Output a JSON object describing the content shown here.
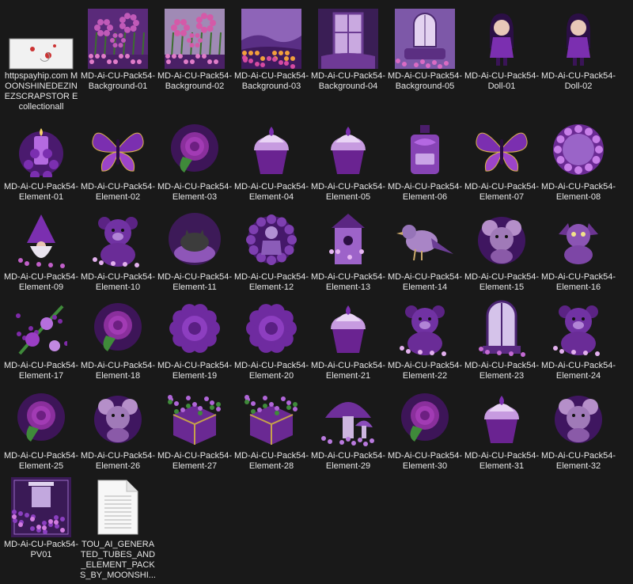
{
  "files": [
    {
      "name": "httpspayhip.com MOONSHINEDEZINEZSCRAPSTOR Ecollectionall",
      "icon": "shortcut-image-icon",
      "kind": "link"
    },
    {
      "name": "MD-Ai-CU-Pack54-Background-01",
      "icon": "garden-background-icon",
      "kind": "bg1"
    },
    {
      "name": "MD-Ai-CU-Pack54-Background-02",
      "icon": "garden-background-icon",
      "kind": "bg2"
    },
    {
      "name": "MD-Ai-CU-Pack54-Background-03",
      "icon": "landscape-background-icon",
      "kind": "bg3"
    },
    {
      "name": "MD-Ai-CU-Pack54-Background-04",
      "icon": "window-background-icon",
      "kind": "bg4"
    },
    {
      "name": "MD-Ai-CU-Pack54-Background-05",
      "icon": "window-background-icon",
      "kind": "bg5"
    },
    {
      "name": "MD-Ai-CU-Pack54-Doll-01",
      "icon": "doll-icon",
      "kind": "doll"
    },
    {
      "name": "MD-Ai-CU-Pack54-Doll-02",
      "icon": "doll-icon",
      "kind": "doll"
    },
    {
      "name": "MD-Ai-CU-Pack54-Element-01",
      "icon": "candle-icon",
      "kind": "candle"
    },
    {
      "name": "MD-Ai-CU-Pack54-Element-02",
      "icon": "butterfly-icon",
      "kind": "butterfly"
    },
    {
      "name": "MD-Ai-CU-Pack54-Element-03",
      "icon": "rose-icon",
      "kind": "rose"
    },
    {
      "name": "MD-Ai-CU-Pack54-Element-04",
      "icon": "cupcake-icon",
      "kind": "cupcake"
    },
    {
      "name": "MD-Ai-CU-Pack54-Element-05",
      "icon": "cupcake-icon",
      "kind": "cupcake"
    },
    {
      "name": "MD-Ai-CU-Pack54-Element-06",
      "icon": "perfume-bottle-icon",
      "kind": "bottle"
    },
    {
      "name": "MD-Ai-CU-Pack54-Element-07",
      "icon": "butterfly-icon",
      "kind": "butterfly"
    },
    {
      "name": "MD-Ai-CU-Pack54-Element-08",
      "icon": "flower-frame-icon",
      "kind": "frame"
    },
    {
      "name": "MD-Ai-CU-Pack54-Element-09",
      "icon": "gnome-icon",
      "kind": "gnome"
    },
    {
      "name": "MD-Ai-CU-Pack54-Element-10",
      "icon": "teddy-bear-icon",
      "kind": "bear"
    },
    {
      "name": "MD-Ai-CU-Pack54-Element-11",
      "icon": "cat-basket-icon",
      "kind": "cat"
    },
    {
      "name": "MD-Ai-CU-Pack54-Element-12",
      "icon": "doll-wreath-icon",
      "kind": "wreath"
    },
    {
      "name": "MD-Ai-CU-Pack54-Element-13",
      "icon": "birdhouse-icon",
      "kind": "birdhouse"
    },
    {
      "name": "MD-Ai-CU-Pack54-Element-14",
      "icon": "bird-icon",
      "kind": "bird"
    },
    {
      "name": "MD-Ai-CU-Pack54-Element-15",
      "icon": "mouse-icon",
      "kind": "mouse"
    },
    {
      "name": "MD-Ai-CU-Pack54-Element-16",
      "icon": "dragon-icon",
      "kind": "dragon"
    },
    {
      "name": "MD-Ai-CU-Pack54-Element-17",
      "icon": "flower-cluster-icon",
      "kind": "cluster"
    },
    {
      "name": "MD-Ai-CU-Pack54-Element-18",
      "icon": "rose-icon",
      "kind": "rose"
    },
    {
      "name": "MD-Ai-CU-Pack54-Element-19",
      "icon": "flower-icon",
      "kind": "flower"
    },
    {
      "name": "MD-Ai-CU-Pack54-Element-20",
      "icon": "flower-icon",
      "kind": "flower"
    },
    {
      "name": "MD-Ai-CU-Pack54-Element-21",
      "icon": "cupcake-icon",
      "kind": "cupcake"
    },
    {
      "name": "MD-Ai-CU-Pack54-Element-22",
      "icon": "teddy-bear-icon",
      "kind": "bear"
    },
    {
      "name": "MD-Ai-CU-Pack54-Element-23",
      "icon": "window-icon",
      "kind": "window"
    },
    {
      "name": "MD-Ai-CU-Pack54-Element-24",
      "icon": "teddy-bear-icon",
      "kind": "bear"
    },
    {
      "name": "MD-Ai-CU-Pack54-Element-25",
      "icon": "rose-icon",
      "kind": "rose"
    },
    {
      "name": "MD-Ai-CU-Pack54-Element-26",
      "icon": "mouse-icon",
      "kind": "mouse"
    },
    {
      "name": "MD-Ai-CU-Pack54-Element-27",
      "icon": "gift-box-icon",
      "kind": "box"
    },
    {
      "name": "MD-Ai-CU-Pack54-Element-28",
      "icon": "flower-box-icon",
      "kind": "box"
    },
    {
      "name": "MD-Ai-CU-Pack54-Element-29",
      "icon": "mushroom-icon",
      "kind": "mushroom"
    },
    {
      "name": "MD-Ai-CU-Pack54-Element-30",
      "icon": "rose-icon",
      "kind": "rose"
    },
    {
      "name": "MD-Ai-CU-Pack54-Element-31",
      "icon": "cupcake-icon",
      "kind": "cupcake"
    },
    {
      "name": "MD-Ai-CU-Pack54-Element-32",
      "icon": "mouse-icon",
      "kind": "mouse"
    },
    {
      "name": "MD-Ai-CU-Pack54-PV01",
      "icon": "preview-image-icon",
      "kind": "preview"
    },
    {
      "name": "TOU_AI_GENERATED_TUBES_AND_ELEMENT_PACKS_BY_MOONSHI...",
      "icon": "text-document-icon",
      "kind": "doc"
    }
  ],
  "colors": {
    "background": "#191919",
    "label_text": "#e6e6e6",
    "purple_dark": "#3a1457",
    "purple_mid": "#7b2fb0",
    "purple_light": "#b46ae0",
    "gold": "#d9b24a",
    "green": "#3f8a3a"
  }
}
